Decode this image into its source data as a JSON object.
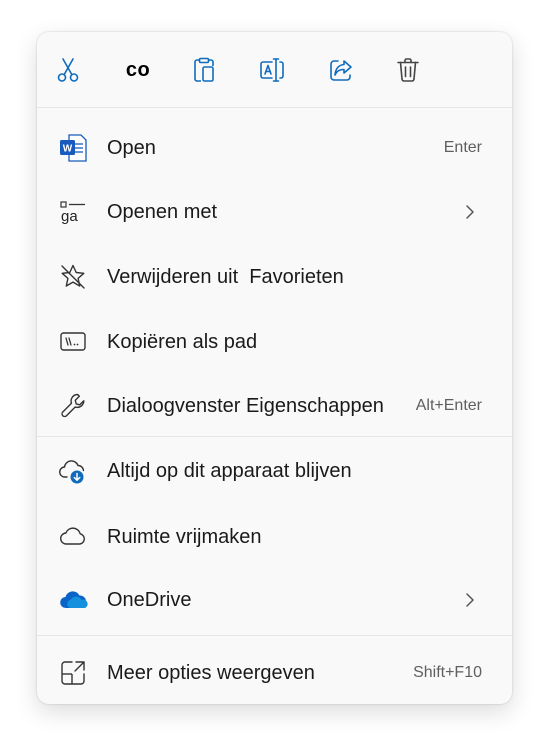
{
  "toolbar": {
    "cut_icon": "scissors-icon",
    "copy_text": "co",
    "paste_icon": "clipboard-icon",
    "rename_icon": "rename-icon",
    "share_icon": "share-icon",
    "delete_icon": "trash-icon"
  },
  "items": [
    {
      "label": "Open",
      "shortcut": "Enter",
      "icon": "word-document-icon"
    },
    {
      "label": "Openen met",
      "icon": "open-with-icon",
      "icon_text": "ga",
      "submenu": true
    },
    {
      "label": "Verwijderen uit  Favorieten",
      "icon": "unfavorite-star-icon"
    },
    {
      "label": "Kopiëren als pad",
      "icon": "copy-path-icon"
    },
    {
      "label": "Dialoogvenster Eigenschappen",
      "shortcut": "Alt+Enter",
      "icon": "wrench-icon"
    },
    {
      "label": "Altijd op dit apparaat blijven",
      "icon": "cloud-download-icon"
    },
    {
      "label": "Ruimte vrijmaken",
      "icon": "cloud-outline-icon"
    },
    {
      "label": "OneDrive",
      "icon": "onedrive-icon",
      "submenu": true
    },
    {
      "label": "Meer opties weergeven",
      "shortcut": "Shift+F10",
      "icon": "more-options-icon"
    }
  ],
  "colors": {
    "accent": "#0f6cbd",
    "onedrive_blue": "#0a64c8",
    "word_blue": "#185abd",
    "menu_bg": "#f9f9f9",
    "separator": "#e5e5e5"
  }
}
